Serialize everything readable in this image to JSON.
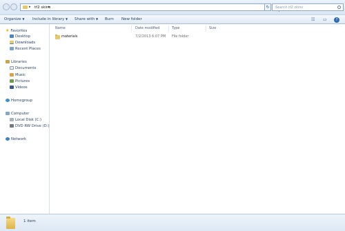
{
  "address": {
    "crumb": "tf2 skins",
    "separator": "▸",
    "crumb_arrow": "▸",
    "dropdown": "▾",
    "refresh_glyph": "↻",
    "search_placeholder": "Search tf2 skins"
  },
  "toolbar": {
    "organize": "Organize",
    "include_in_library": "Include in library",
    "share_with": "Share with",
    "burn": "Burn",
    "new_folder": "New folder",
    "dropdown_arrow": "▼",
    "views_glyph": "☷",
    "pane_glyph": "▭",
    "help_glyph": "?"
  },
  "nav": {
    "favorites": "Favorites",
    "favorites_items": [
      "Desktop",
      "Downloads",
      "Recent Places"
    ],
    "libraries": "Libraries",
    "libraries_items": [
      "Documents",
      "Music",
      "Pictures",
      "Videos"
    ],
    "homegroup": "Homegroup",
    "computer": "Computer",
    "computer_items": [
      "Local Disk (C:)",
      "DVD RW Drive (D:) H"
    ],
    "network": "Network",
    "star_glyph": "★"
  },
  "columns": {
    "name": "Name",
    "date_modified": "Date modified",
    "type": "Type",
    "size": "Size"
  },
  "rows": [
    {
      "name": "materials",
      "date_modified": "7/2/2013 6:07 PM",
      "type": "File folder",
      "size": ""
    }
  ],
  "details": {
    "item_count": "1 item"
  },
  "colors": {
    "folder": "#e8c866",
    "toolbar_bg": "#dfe9f5",
    "text": "#1e395b"
  }
}
